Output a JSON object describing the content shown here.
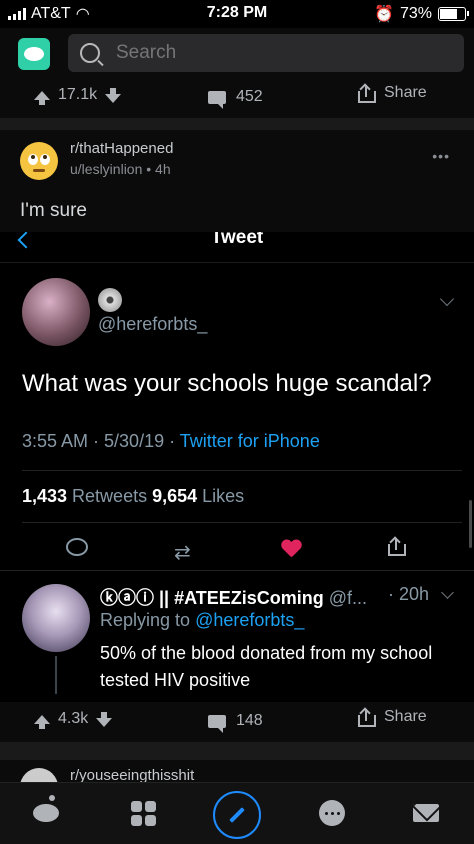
{
  "status_bar": {
    "carrier": "AT&T",
    "time": "7:28 PM",
    "battery": "73%",
    "battery_level": 0.73
  },
  "search": {
    "placeholder": "Search"
  },
  "prev_post_actions": {
    "upvotes": "17.1k",
    "comments": "452",
    "share": "Share"
  },
  "post": {
    "subreddit": "r/thatHappened",
    "meta": "u/leslyinlion • 4h",
    "more": "•••",
    "title": "I'm sure"
  },
  "tweet": {
    "header": "Tweet",
    "handle": "@hereforbts_",
    "text": "What was your schools huge scandal?",
    "timestamp": "3:55 AM · 5/30/19 · ",
    "source": "Twitter for iPhone",
    "retweets_count": "1,433",
    "retweets_label": " Retweets ",
    "likes_count": "9,654",
    "likes_label": " Likes",
    "reply": {
      "name": "ⓚⓐⓘ || #ATEEZisComing",
      "handle": " @f...",
      "time": "· 20h",
      "replying_prefix": "Replying to ",
      "replying_to": "@hereforbts_",
      "text": "50% of the blood donated from my school tested HIV positive"
    }
  },
  "post_actions": {
    "upvotes": "4.3k",
    "comments": "148",
    "share": "Share"
  },
  "next_post": {
    "subreddit": "r/youseeingthisshit"
  },
  "icons": [
    "reddit-logo-icon",
    "search-icon",
    "upvote-icon",
    "downvote-icon",
    "comment-icon",
    "share-icon",
    "emoji-icon",
    "back-icon",
    "cd-icon",
    "chevron-down-icon",
    "reply-icon",
    "retweet-icon",
    "heart-icon",
    "home-icon",
    "communities-icon",
    "create-post-icon",
    "chat-icon",
    "inbox-icon"
  ],
  "colors": {
    "accent_blue": "#1da1f2",
    "like_red": "#e0245e",
    "post_button": "#1e8bff"
  }
}
